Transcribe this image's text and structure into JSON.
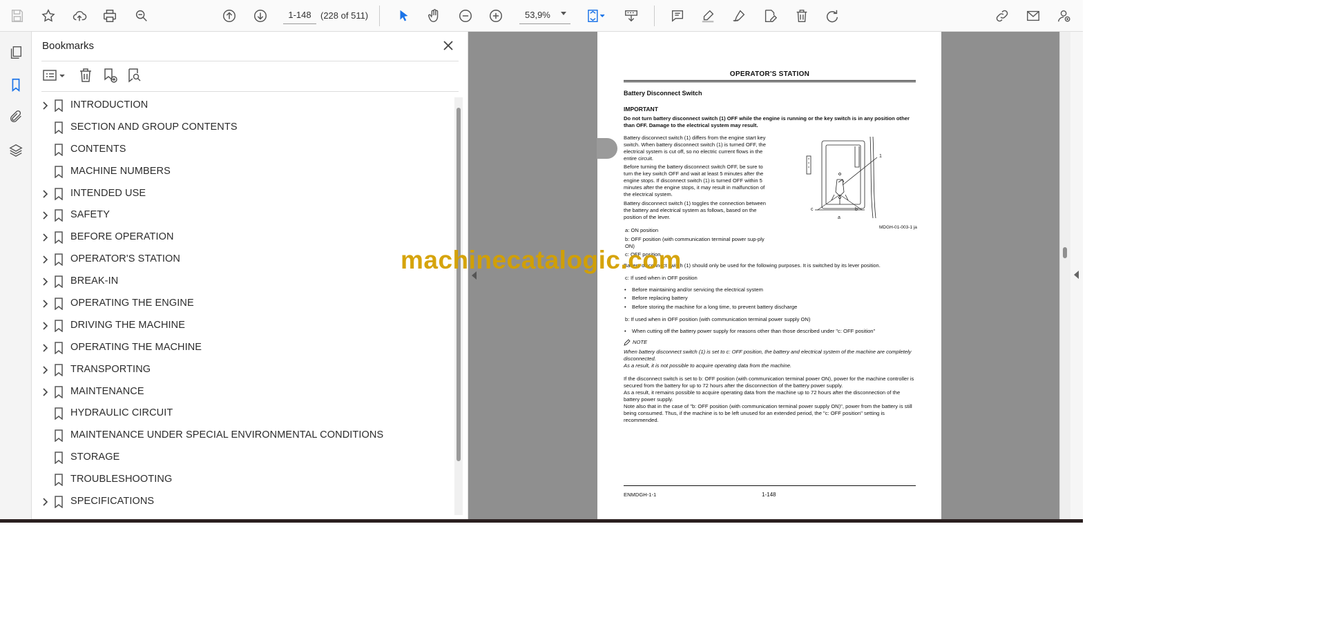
{
  "toolbar": {
    "page_current": "1-148",
    "page_count": "(228 of 511)",
    "zoom": "53,9%"
  },
  "bookmarks": {
    "title": "Bookmarks",
    "items": [
      {
        "label": "INTRODUCTION",
        "expandable": true
      },
      {
        "label": "SECTION AND GROUP CONTENTS",
        "expandable": false
      },
      {
        "label": "CONTENTS",
        "expandable": false
      },
      {
        "label": "MACHINE NUMBERS",
        "expandable": false
      },
      {
        "label": "INTENDED USE",
        "expandable": true
      },
      {
        "label": "SAFETY",
        "expandable": true
      },
      {
        "label": "BEFORE OPERATION",
        "expandable": true
      },
      {
        "label": "OPERATOR'S STATION",
        "expandable": true
      },
      {
        "label": "BREAK-IN",
        "expandable": true
      },
      {
        "label": "OPERATING THE ENGINE",
        "expandable": true
      },
      {
        "label": "DRIVING THE MACHINE",
        "expandable": true
      },
      {
        "label": "OPERATING THE MACHINE",
        "expandable": true
      },
      {
        "label": "TRANSPORTING",
        "expandable": true
      },
      {
        "label": "MAINTENANCE",
        "expandable": true
      },
      {
        "label": "HYDRAULIC CIRCUIT",
        "expandable": false
      },
      {
        "label": "MAINTENANCE UNDER SPECIAL ENVIRONMENTAL CONDITIONS",
        "expandable": false
      },
      {
        "label": "STORAGE",
        "expandable": false
      },
      {
        "label": "TROUBLESHOOTING",
        "expandable": false
      },
      {
        "label": "SPECIFICATIONS",
        "expandable": true
      }
    ]
  },
  "document": {
    "header": "OPERATOR'S STATION",
    "section": "Battery Disconnect Switch",
    "important_label": "IMPORTANT",
    "important_text": "Do not turn battery disconnect switch (1) OFF while the engine is running or the key switch is in any position other than OFF. Damage to the electrical system may result.",
    "para1": "Battery disconnect switch (1) differs from the engine start key switch. When battery disconnect switch (1) is turned OFF, the electrical system is cut off, so no electric current flows in the entire circuit.",
    "para2": "Before turning the battery disconnect switch OFF, be sure to turn the key switch OFF and wait at least 5 minutes after the engine stops. If disconnect switch (1) is turned OFF within 5 minutes after the engine stops, it may result in malfunction of the electrical system.",
    "para3": "Battery disconnect switch (1) toggles the connection between the battery and electrical system as follows, based on the position of the lever.",
    "pos_a": "a: ON position",
    "pos_b": "b: OFF position (with communication terminal power sup-ply ON)",
    "pos_c": "c: OFF position",
    "fig_caption": "MDGH-01-003-1 ja",
    "fig_label_1": "1",
    "fig_label_a": "a",
    "fig_label_b": "b",
    "fig_label_c": "c",
    "purpose": "Battery disconnect switch (1) should only be used for the following purposes. It is switched by its lever position.",
    "c_used": "c: If used when in OFF position",
    "bullet1": "Before maintaining and/or servicing the electrical system",
    "bullet2": "Before replacing battery",
    "bullet3": "Before storing the machine for a long time, to prevent battery discharge",
    "b_used": "b: If used when in OFF position (with communication terminal power supply ON)",
    "bullet4": "When cutting off the battery power supply for reasons other than those described under \"c: OFF position\"",
    "note_label": "NOTE",
    "note1": "When battery disconnect switch (1) is set to c: OFF position, the battery and electrical system of the machine are completely disconnected.",
    "note2": "As a result, it is not possible to acquire operating data from the machine.",
    "para4": "If the disconnect switch is set to b: OFF position (with communication terminal power ON), power for the machine controller is secured from the battery for up to 72 hours after the disconnection of the battery power supply.",
    "para5": "As a result, it remains possible to acquire operating data from the machine up to 72 hours after the disconnection of the battery power supply.",
    "para6": "Note also that in the case of \"b: OFF position (with communication terminal power supply ON)\", power from the battery is still being consumed. Thus, if the machine is to be left unused for an extended period, the \"c: OFF position\" setting is recommended.",
    "footer_left": "ENMDGH-1-1",
    "footer_page": "1-148"
  },
  "watermark": "machinecatalogic.com"
}
